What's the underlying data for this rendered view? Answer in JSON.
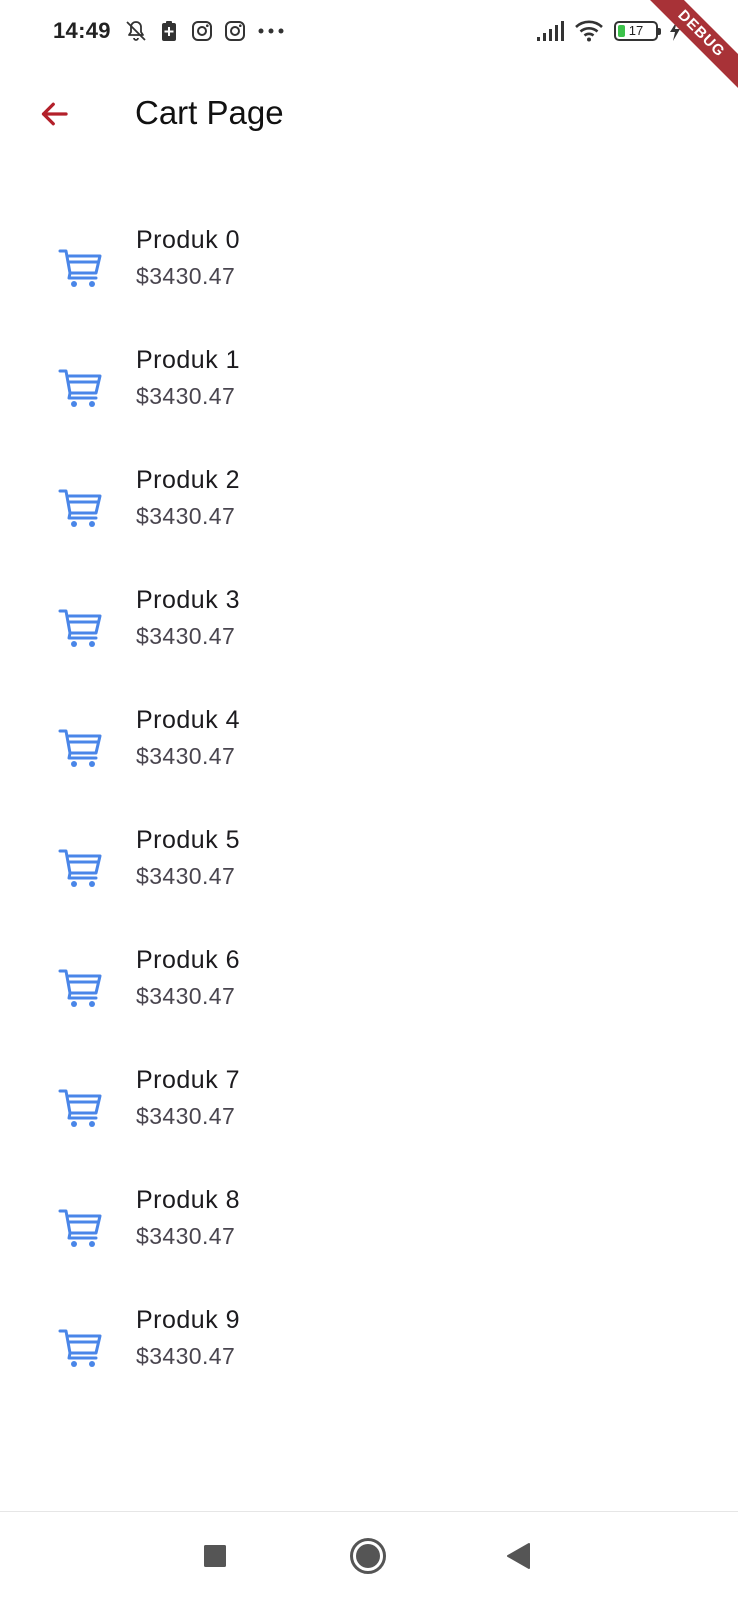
{
  "status_bar": {
    "time": "14:49",
    "battery_level": "17",
    "left_icons": [
      "notifications-off-icon",
      "battery-saver-icon",
      "instagram-icon",
      "instagram-icon",
      "more-icon"
    ],
    "right_icons": [
      "signal-icon",
      "wifi-icon",
      "battery-icon",
      "charging-icon"
    ]
  },
  "debug_banner": "DEBUG",
  "app_bar": {
    "title": "Cart Page",
    "back_icon": "arrow-back-icon",
    "back_color": "#b3202a"
  },
  "cart": {
    "icon": "shopping-cart-icon",
    "icon_color": "#4a86e8",
    "items": [
      {
        "name": "Produk 0",
        "price": "$3430.47"
      },
      {
        "name": "Produk 1",
        "price": "$3430.47"
      },
      {
        "name": "Produk 2",
        "price": "$3430.47"
      },
      {
        "name": "Produk 3",
        "price": "$3430.47"
      },
      {
        "name": "Produk 4",
        "price": "$3430.47"
      },
      {
        "name": "Produk 5",
        "price": "$3430.47"
      },
      {
        "name": "Produk 6",
        "price": "$3430.47"
      },
      {
        "name": "Produk 7",
        "price": "$3430.47"
      },
      {
        "name": "Produk 8",
        "price": "$3430.47"
      },
      {
        "name": "Produk 9",
        "price": "$3430.47"
      }
    ]
  },
  "nav_bar": {
    "buttons": [
      "recents-square-icon",
      "home-circle-icon",
      "back-triangle-icon"
    ]
  }
}
